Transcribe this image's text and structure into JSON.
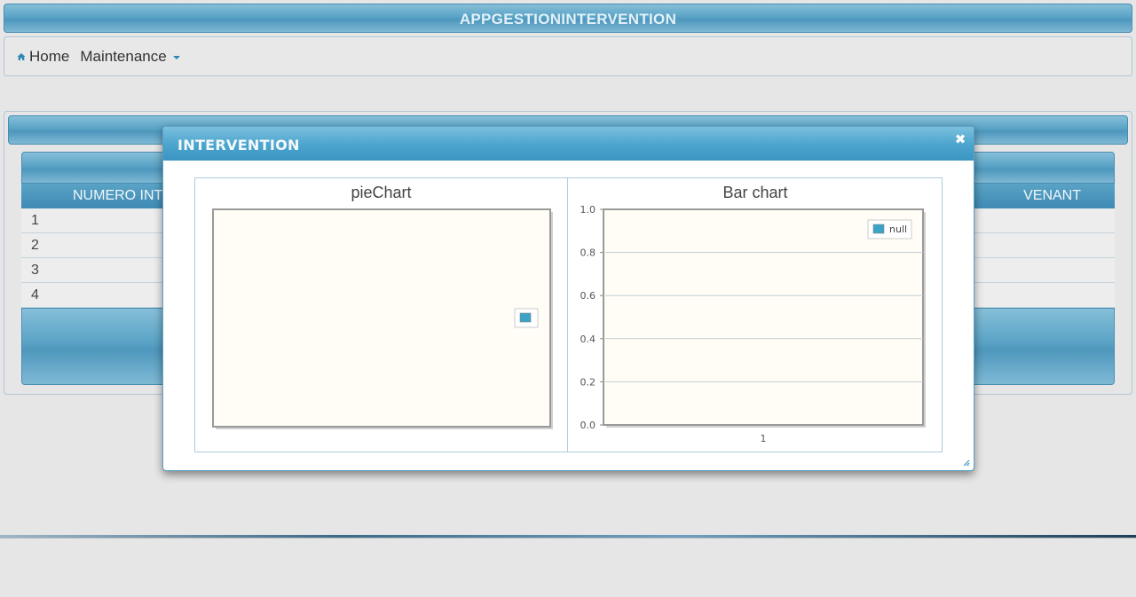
{
  "app": {
    "title": "APPGESTIONINTERVENTION"
  },
  "menubar": {
    "home_label": "Home",
    "maintenance_label": "Maintenance"
  },
  "table": {
    "col_left_label": "NUMERO INT",
    "col_right_label": "VENANT",
    "rows": [
      "1",
      "2",
      "3",
      "4"
    ]
  },
  "dialog": {
    "title": "INTERVENTION",
    "close_icon": "close-icon"
  },
  "chart_data": [
    {
      "type": "pie",
      "title": "pieChart",
      "series": [
        {
          "name": "",
          "values": []
        }
      ],
      "legend": "right"
    },
    {
      "type": "bar",
      "title": "Bar chart",
      "categories": [
        "1"
      ],
      "series": [
        {
          "name": "null",
          "values": []
        }
      ],
      "ylim": [
        0,
        1.0
      ],
      "yticks": [
        "0.0",
        "0.2",
        "0.4",
        "0.6",
        "0.8",
        "1.0"
      ],
      "legend": "top-right",
      "grid": true
    }
  ],
  "colors": {
    "accent": "#4ea6cf",
    "legend_swatch": "#3aa3c6",
    "plot_bg": "#fffdf6"
  }
}
